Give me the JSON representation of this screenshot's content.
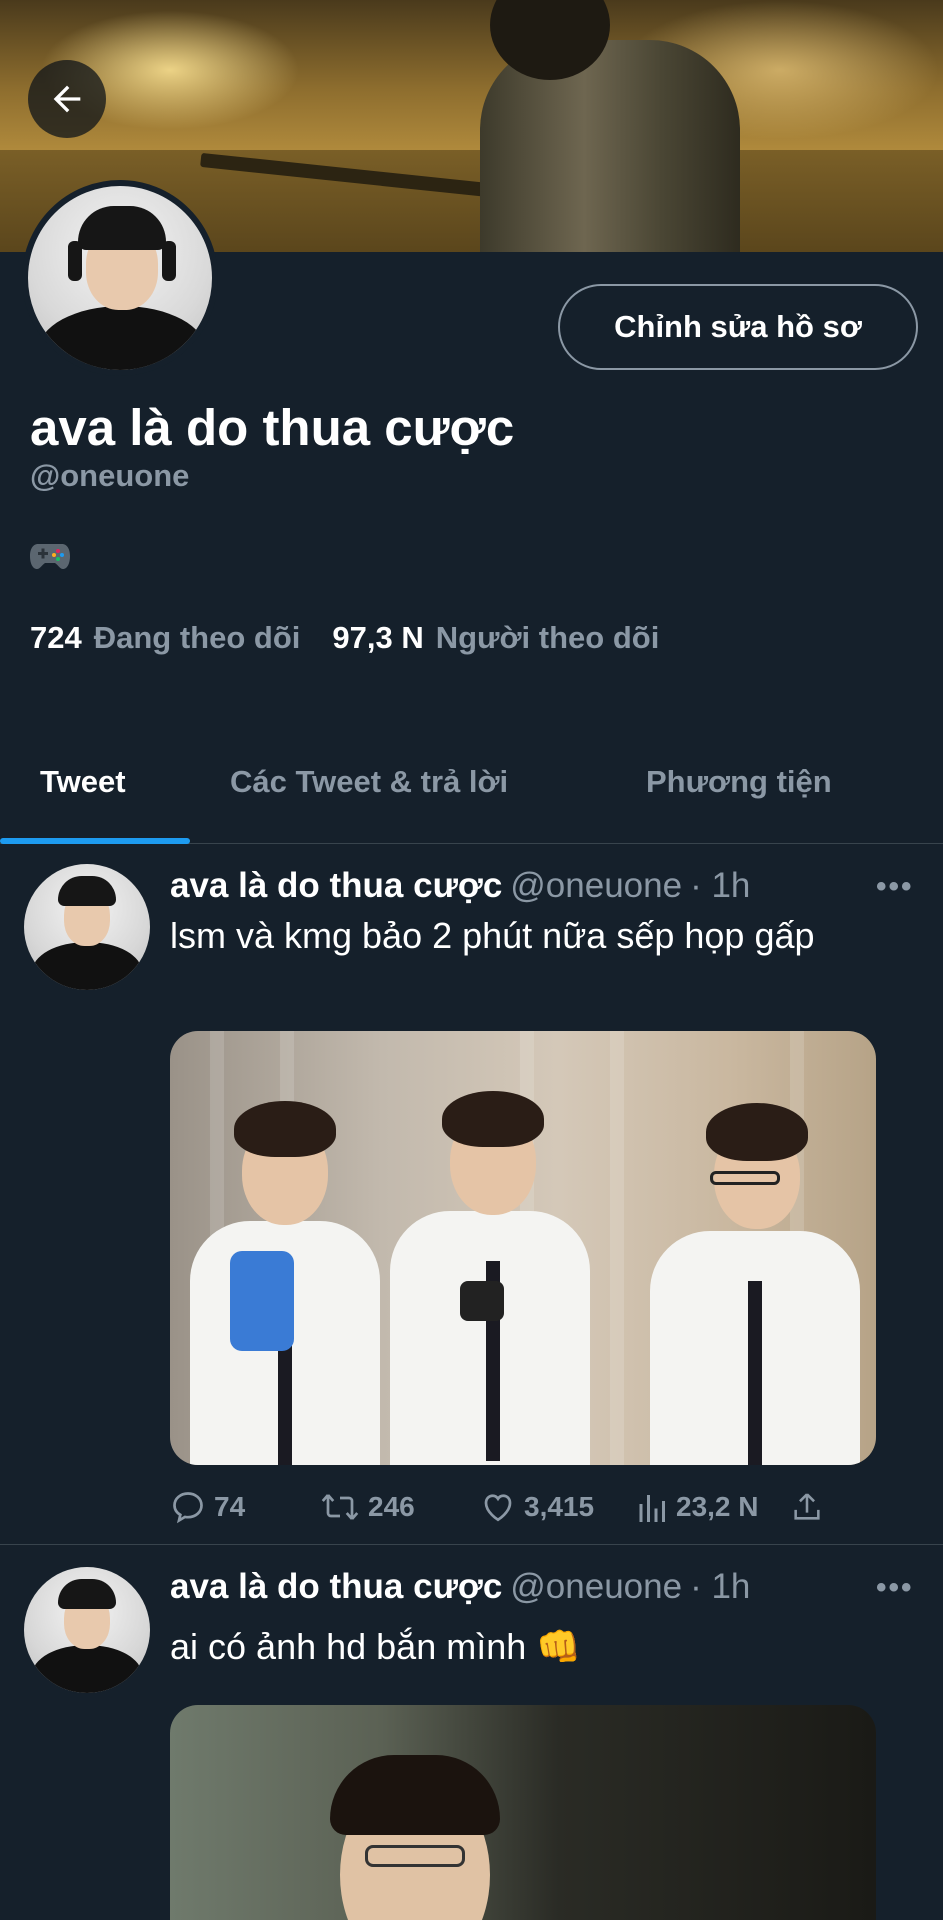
{
  "header": {
    "back_icon": "arrow-left-icon"
  },
  "profile": {
    "edit_button_label": "Chỉnh sửa hồ sơ",
    "display_name": "ava là do thua cược",
    "handle": "@oneuone",
    "bio_icon": "game-controller-icon",
    "following_count": "724",
    "following_label": "Đang theo dõi",
    "followers_count": "97,3 N",
    "followers_label": "Người theo dõi"
  },
  "tabs": [
    {
      "label": "Tweet",
      "active": true
    },
    {
      "label": "Các Tweet & trả lời",
      "active": false
    },
    {
      "label": "Phương tiện",
      "active": false
    }
  ],
  "tweets": [
    {
      "author_name": "ava là do thua cược",
      "author_handle": "@oneuone",
      "time": "· 1h",
      "text": "lsm và kmg bảo 2 phút nữa sếp họp gấp",
      "replies": "74",
      "retweets": "246",
      "likes": "3,415",
      "views": "23,2 N"
    },
    {
      "author_name": "ava là do thua cược",
      "author_handle": "@oneuone",
      "time": "· 1h",
      "text": "ai có ảnh hd bắn mình 👊"
    }
  ],
  "colors": {
    "background": "#15202b",
    "muted_text": "#8b98a5",
    "accent": "#1d9bf0",
    "divider": "#38444d"
  }
}
